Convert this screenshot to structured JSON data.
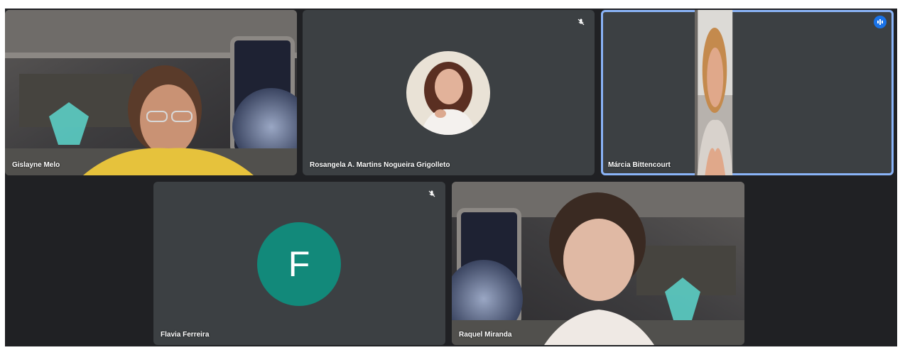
{
  "participants": [
    {
      "name": "Gislayne Melo",
      "mode": "camera",
      "speaking": false,
      "muted": false
    },
    {
      "name": "Rosangela A. Martins Nogueira Grigolleto",
      "mode": "photo-avatar",
      "speaking": false,
      "muted": true
    },
    {
      "name": "Márcia Bittencourt",
      "mode": "camera",
      "speaking": true,
      "muted": false
    },
    {
      "name": "Flavia Ferreira",
      "mode": "letter-avatar",
      "avatar_letter": "F",
      "speaking": false,
      "muted": true
    },
    {
      "name": "Raquel Miranda",
      "mode": "camera",
      "speaking": false,
      "muted": false
    }
  ],
  "icons": {
    "muted": "mic-off-icon",
    "speaking": "audio-level-icon"
  },
  "colors": {
    "background": "#202124",
    "tile": "#3c4043",
    "active_outline": "#8ab4f8",
    "speaking_badge": "#1a73e8",
    "letter_avatar": "#12897a"
  }
}
